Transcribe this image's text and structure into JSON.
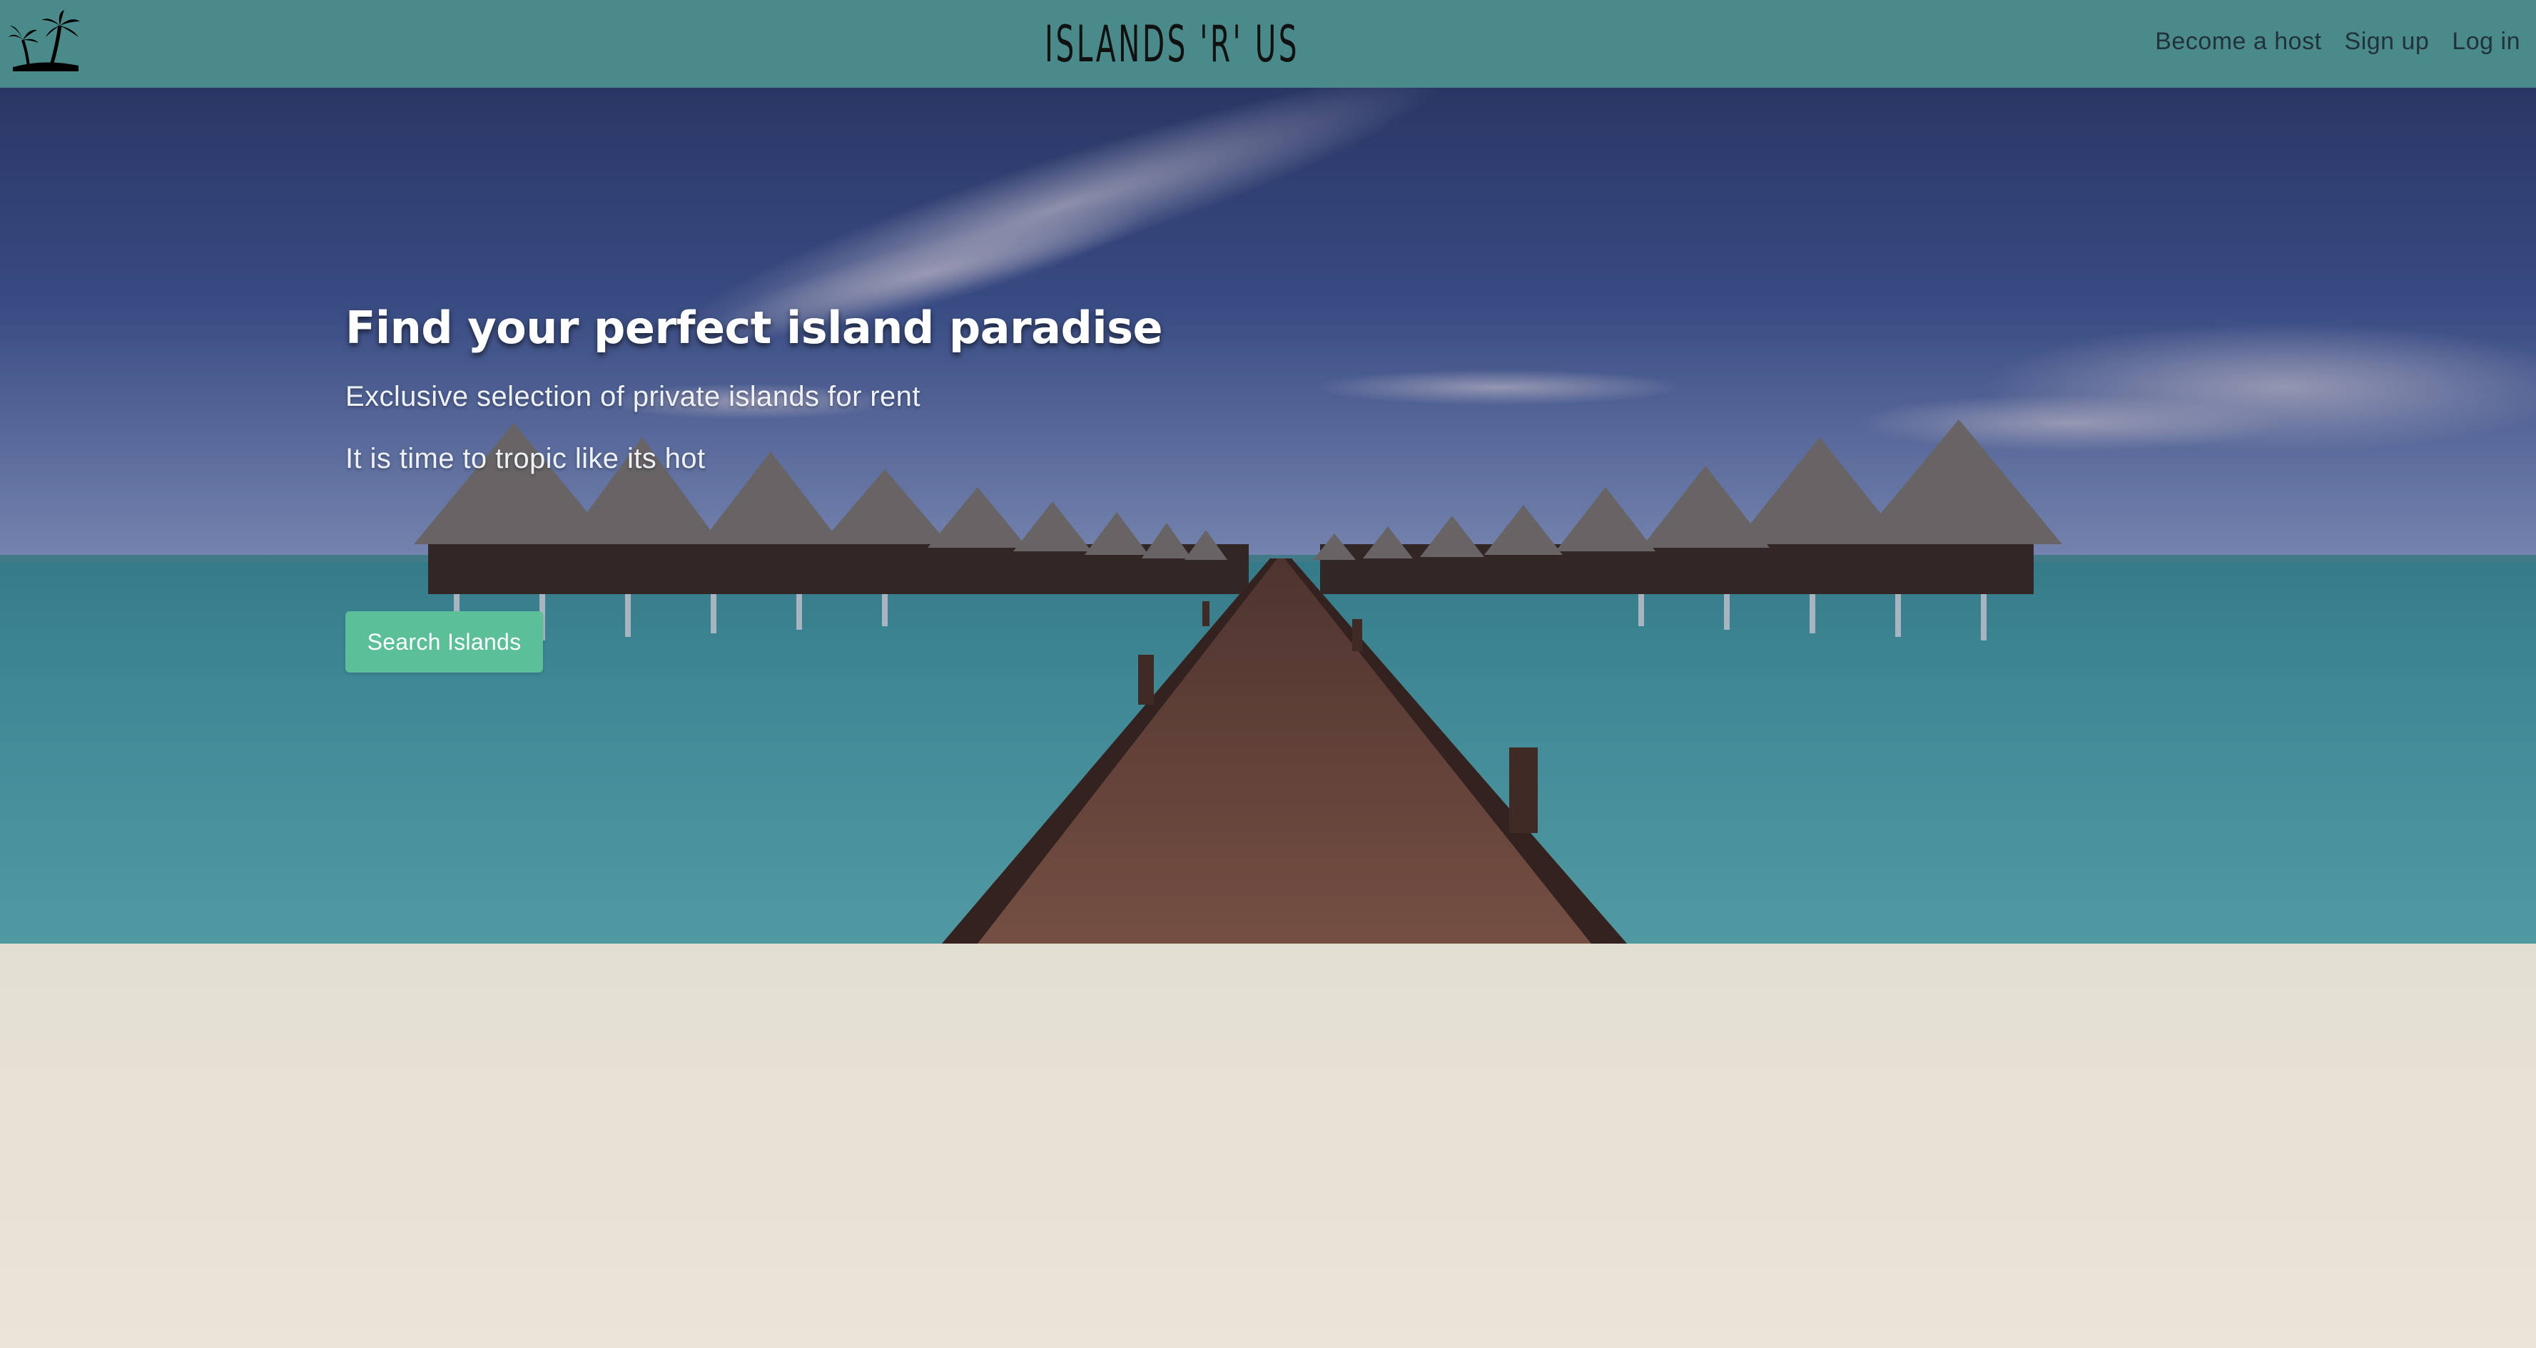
{
  "header": {
    "brand": "ISLANDS 'R' US",
    "logo_icon": "palm-trees-icon",
    "nav": [
      {
        "label": "Become a host"
      },
      {
        "label": "Sign up"
      },
      {
        "label": "Log in"
      }
    ]
  },
  "hero": {
    "title": "Find your perfect island paradise",
    "subtitle": "Exclusive selection of private islands for rent",
    "tagline": "It is time to tropic like its hot",
    "cta_label": "Search Islands",
    "background": "overwater-bungalows-pier-photo"
  },
  "colors": {
    "navbar": "#4b8a8a",
    "accent": "#5bbf98",
    "page_bottom": "#ebe4d8"
  }
}
